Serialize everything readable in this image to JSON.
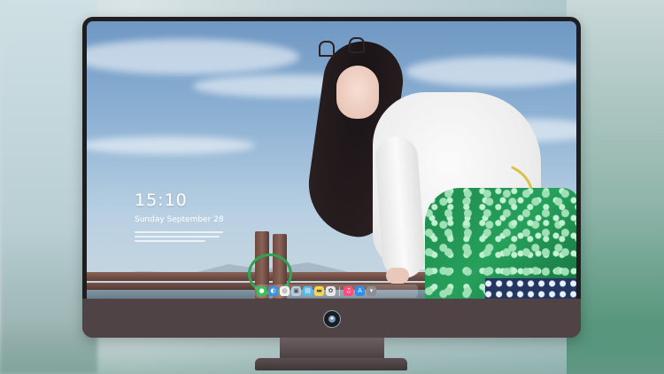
{
  "lock_screen": {
    "time": "15:10",
    "date": "Sunday September 28"
  },
  "dock": {
    "icons": [
      {
        "name": "messages-icon",
        "color": "#3cc15a",
        "glyph": "●"
      },
      {
        "name": "finder-icon",
        "color": "#3b8fe6",
        "glyph": "◐"
      },
      {
        "name": "safari-icon",
        "color": "#f2f2f2",
        "glyph": "◎"
      },
      {
        "name": "preview-icon",
        "color": "#b4cde0",
        "glyph": "▣"
      },
      {
        "name": "claquette-icon",
        "color": "#5bb7e6",
        "glyph": "▤"
      },
      {
        "name": "notes-icon",
        "color": "#f7d64a",
        "glyph": "▬"
      },
      {
        "name": "photos-icon",
        "color": "#e8e8e8",
        "glyph": "✿"
      },
      {
        "name": "music-icon",
        "color": "#fa4d7a",
        "glyph": "♫"
      },
      {
        "name": "app-store-icon",
        "color": "#2f8ff0",
        "glyph": "A"
      },
      {
        "name": "trash-icon",
        "color": "#8e8e93",
        "glyph": "▾"
      }
    ]
  },
  "colors": {
    "monitor_frame": "#211d1f",
    "monitor_chin": "#4f4345",
    "sky_top": "#6f98c3"
  }
}
